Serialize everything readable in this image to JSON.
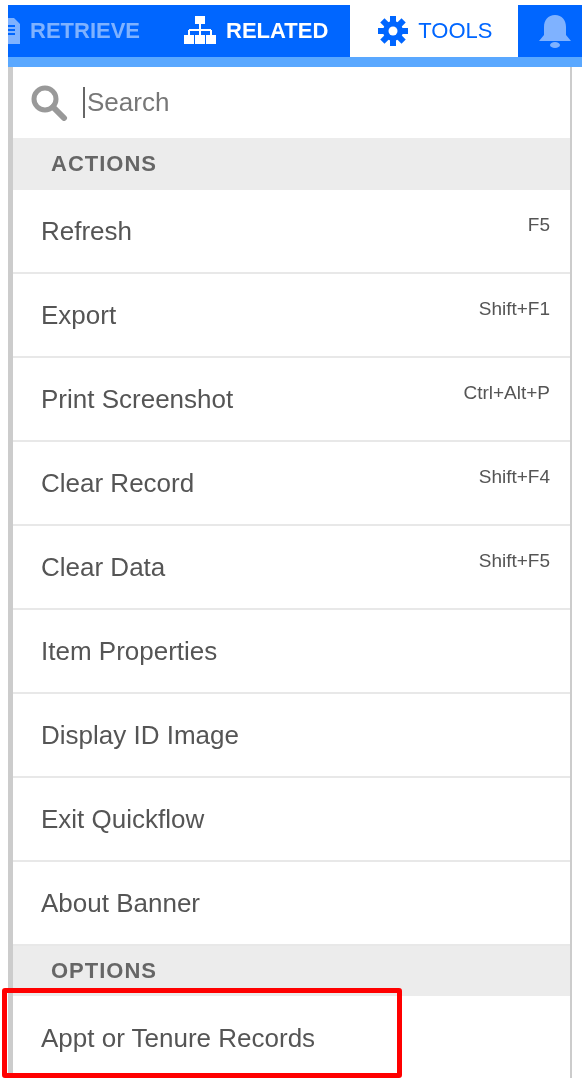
{
  "tabs": [
    {
      "label": "RETRIEVE",
      "selected": false,
      "disabled": true
    },
    {
      "label": "RELATED",
      "selected": false,
      "disabled": false
    },
    {
      "label": "TOOLS",
      "selected": true,
      "disabled": false
    },
    {
      "selected": false,
      "disabled": true
    }
  ],
  "search": {
    "placeholder": "Search"
  },
  "sections": [
    {
      "title": "ACTIONS",
      "items": [
        {
          "label": "Refresh",
          "shortcut": "F5",
          "highlighted": false
        },
        {
          "label": "Export",
          "shortcut": "Shift+F1",
          "highlighted": false
        },
        {
          "label": "Print Screenshot",
          "shortcut": "Ctrl+Alt+P",
          "highlighted": false
        },
        {
          "label": "Clear Record",
          "shortcut": "Shift+F4",
          "highlighted": false
        },
        {
          "label": "Clear Data",
          "shortcut": "Shift+F5",
          "highlighted": false
        },
        {
          "label": "Item Properties",
          "highlighted": false
        },
        {
          "label": "Display ID Image",
          "highlighted": false
        },
        {
          "label": "Exit Quickflow",
          "highlighted": false
        },
        {
          "label": "About Banner",
          "highlighted": false
        }
      ]
    },
    {
      "title": "OPTIONS",
      "items": [
        {
          "label": "Appt or Tenure Records",
          "highlighted": true
        }
      ]
    }
  ]
}
